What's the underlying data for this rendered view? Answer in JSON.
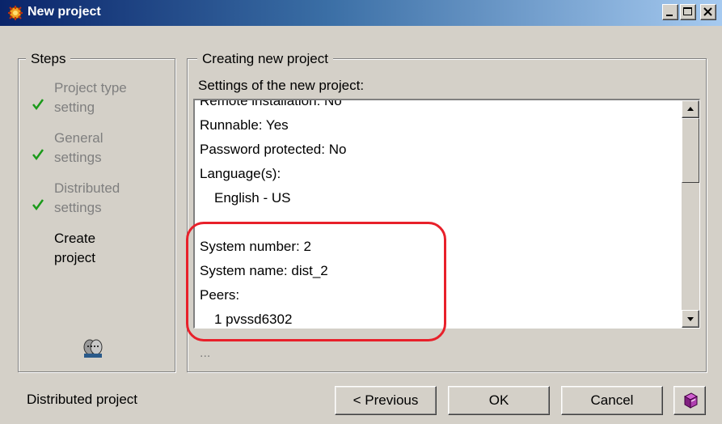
{
  "window": {
    "title": "New project",
    "controls": {
      "minimize_icon": "minimize-icon",
      "maximize_icon": "maximize-icon",
      "close_icon": "close-icon"
    }
  },
  "steps": {
    "legend": "Steps",
    "items": [
      {
        "lines": [
          "Project type",
          "setting"
        ],
        "done": true
      },
      {
        "lines": [
          "General",
          "settings"
        ],
        "done": true
      },
      {
        "lines": [
          "Distributed",
          "settings"
        ],
        "done": true
      },
      {
        "lines": [
          "Create",
          "project"
        ],
        "done": false
      }
    ],
    "icon": "people-icon"
  },
  "main": {
    "legend": "Creating new project",
    "settings_label": "Settings of the new project:",
    "list": [
      {
        "text": "Remote installation: No",
        "indent": false
      },
      {
        "text": "Runnable: Yes",
        "indent": false
      },
      {
        "text": "Password protected: No",
        "indent": false
      },
      {
        "text": "Language(s):",
        "indent": false
      },
      {
        "text": "English - US",
        "indent": true
      },
      {
        "text": "",
        "indent": false
      },
      {
        "text": "System number: 2",
        "indent": false
      },
      {
        "text": "System name: dist_2",
        "indent": false
      },
      {
        "text": "Peers:",
        "indent": false
      },
      {
        "text": "1 pvssd6302",
        "indent": true
      }
    ],
    "ellipsis": "..."
  },
  "footer": {
    "label": "Distributed project",
    "previous_label": "< Previous",
    "ok_label": "OK",
    "cancel_label": "Cancel",
    "help_icon": "help-book-icon"
  },
  "colors": {
    "title_gradient_start": "#0a246a",
    "title_gradient_end": "#a6caf0",
    "check": "#1a9a1a",
    "annotation": "#e8202a",
    "disabled_text": "#7f7f7f"
  }
}
